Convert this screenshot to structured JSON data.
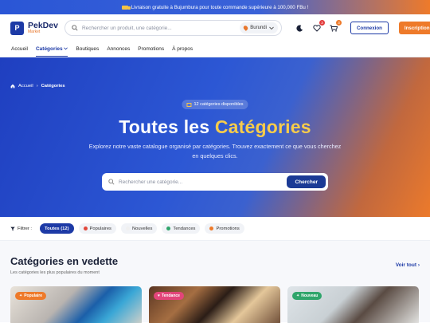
{
  "promo": {
    "text": "Livraison gratuite à Bujumbura pour toute commande supérieure à 100,000 FBu !"
  },
  "brand": {
    "letter": "P",
    "name": "PekDev",
    "tagline": "Market"
  },
  "search": {
    "placeholder": "Rechercher un produit, une catégorie...",
    "location": "Burundi"
  },
  "header": {
    "wishlist_count": "3",
    "cart_count": "3",
    "login_label": "Connexion",
    "signup_label": "Inscription"
  },
  "nav": {
    "items": [
      {
        "label": "Accueil"
      },
      {
        "label": "Catégories"
      },
      {
        "label": "Boutiques"
      },
      {
        "label": "Annonces"
      },
      {
        "label": "Promotions"
      },
      {
        "label": "À propos"
      }
    ]
  },
  "hero": {
    "breadcrumb_home": "Accueil",
    "breadcrumb_current": "Catégories",
    "count_pill": "12 catégories disponibles",
    "title_prefix": "Toutes les",
    "title_highlight": "Catégories",
    "subtitle": "Explorez notre vaste catalogue organisé par catégories. Trouvez exactement ce que vous cherchez en quelques clics.",
    "search_placeholder": "Rechercher une catégorie...",
    "search_button": "Chercher"
  },
  "filters": {
    "label": "Filtrer :",
    "chips": [
      {
        "label": "Toutes (12)"
      },
      {
        "label": "Populaires"
      },
      {
        "label": "Nouvelles"
      },
      {
        "label": "Tendances"
      },
      {
        "label": "Promotions"
      }
    ]
  },
  "featured": {
    "title": "Catégories en vedette",
    "subtitle": "Les catégories les plus populaires du moment",
    "see_all": "Voir tout",
    "cards": [
      {
        "tag": "Populaire"
      },
      {
        "tag": "Tendance"
      },
      {
        "tag": "Nouveau"
      }
    ]
  },
  "colors": {
    "primary": "#1d3aa6",
    "accent": "#ee7a2a",
    "highlight": "#f7cc4b"
  }
}
